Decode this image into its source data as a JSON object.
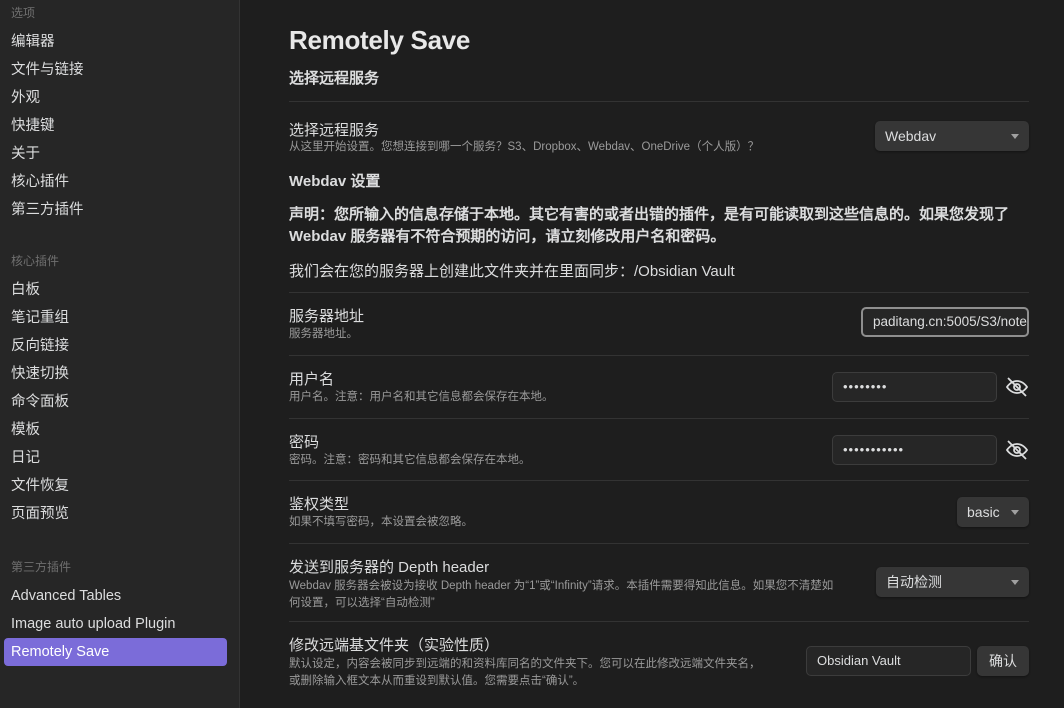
{
  "sidebar": {
    "options_header": "选项",
    "options": [
      "编辑器",
      "文件与链接",
      "外观",
      "快捷键",
      "关于",
      "核心插件",
      "第三方插件"
    ],
    "core_header": "核心插件",
    "core": [
      "白板",
      "笔记重组",
      "反向链接",
      "快速切换",
      "命令面板",
      "模板",
      "日记",
      "文件恢复",
      "页面预览"
    ],
    "third_header": "第三方插件",
    "third": [
      "Advanced Tables",
      "Image auto upload Plugin",
      "Remotely Save"
    ],
    "active_item": "Remotely Save"
  },
  "main": {
    "title": "Remotely Save",
    "section_choose": "选择远程服务",
    "service": {
      "name": "选择远程服务",
      "desc": "从这里开始设置。您想连接到哪一个服务？S3、Dropbox、Webdav、OneDrive（个人版）？",
      "value": "Webdav"
    },
    "webdav_heading": "Webdav 设置",
    "disclaimer_line1": "声明：您所输入的信息存储于本地。其它有害的或者出错的插件，是有可能读取到这些信息的。如果您发现了",
    "disclaimer_line2": "Webdav 服务器有不符合预期的访问，请立刻修改用户名和密码。",
    "folder_note": "我们会在您的服务器上创建此文件夹并在里面同步：/Obsidian Vault",
    "server": {
      "name": "服务器地址",
      "desc": "服务器地址。",
      "value": "paditang.cn:5005/S3/note"
    },
    "username": {
      "name": "用户名",
      "desc": "用户名。注意：用户名和其它信息都会保存在本地。",
      "value": "••••••••"
    },
    "password": {
      "name": "密码",
      "desc": "密码。注意：密码和其它信息都会保存在本地。",
      "value": "•••••••••••"
    },
    "auth": {
      "name": "鉴权类型",
      "desc": "如果不填写密码，本设置会被忽略。",
      "value": "basic"
    },
    "depth": {
      "name": "发送到服务器的 Depth header",
      "desc_line1": "Webdav 服务器会被设为接收 Depth header 为“1”或“Infinity”请求。本插件需要得知此信息。如果您不清楚如",
      "desc_line2": "何设置，可以选择“自动检测”",
      "value": "自动检测"
    },
    "remote_base": {
      "name": "修改远端基文件夹（实验性质）",
      "desc_line1": "默认设定，内容会被同步到远端的和资料库同名的文件夹下。您可以在此修改远端文件夹名，",
      "desc_line2": "或删除输入框文本从而重设到默认值。您需要点击“确认”。",
      "value": "Obsidian Vault",
      "confirm": "确认"
    }
  },
  "colors": {
    "accent": "#7b6cd9",
    "background": "#1e1e1e",
    "sidebar": "#262626"
  }
}
